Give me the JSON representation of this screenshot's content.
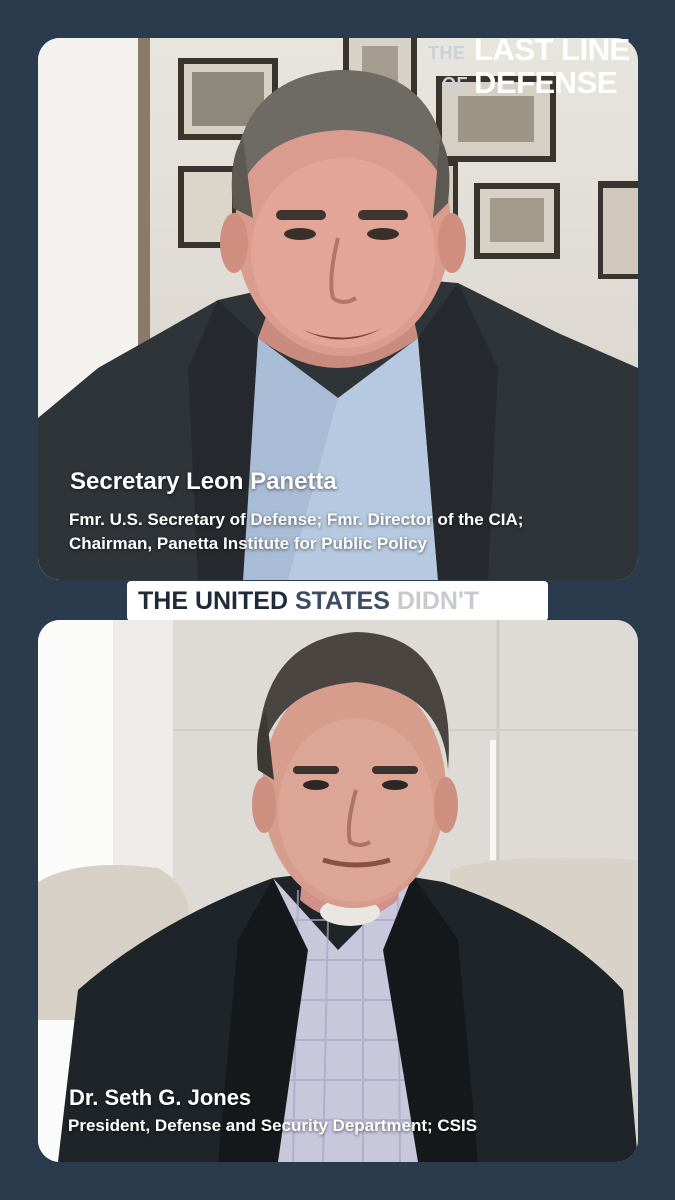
{
  "brand": {
    "the": "THE",
    "of": "OF",
    "line1": "LAST LINE",
    "line2": "DEFENSE"
  },
  "caption": {
    "words": [
      "THE",
      "UNITED",
      "STATES",
      "DIDN'T"
    ],
    "colors": [
      "#1e2a38",
      "#1e2a38",
      "#3b4c63",
      "#c7cbd0"
    ]
  },
  "speakers": [
    {
      "name": "Secretary Leon Panetta",
      "title_line1": "Fmr. U.S. Secretary of Defense; Fmr. Director of the CIA;",
      "title_line2": "Chairman, Panetta Institute for Public Policy"
    },
    {
      "name": "Dr. Seth G. Jones",
      "title_line1": "President, Defense and Security Department; CSIS"
    }
  ],
  "colors": {
    "background": "#2b3b4e",
    "caption_bg": "#ffffff",
    "name_text": "#ffffff"
  }
}
